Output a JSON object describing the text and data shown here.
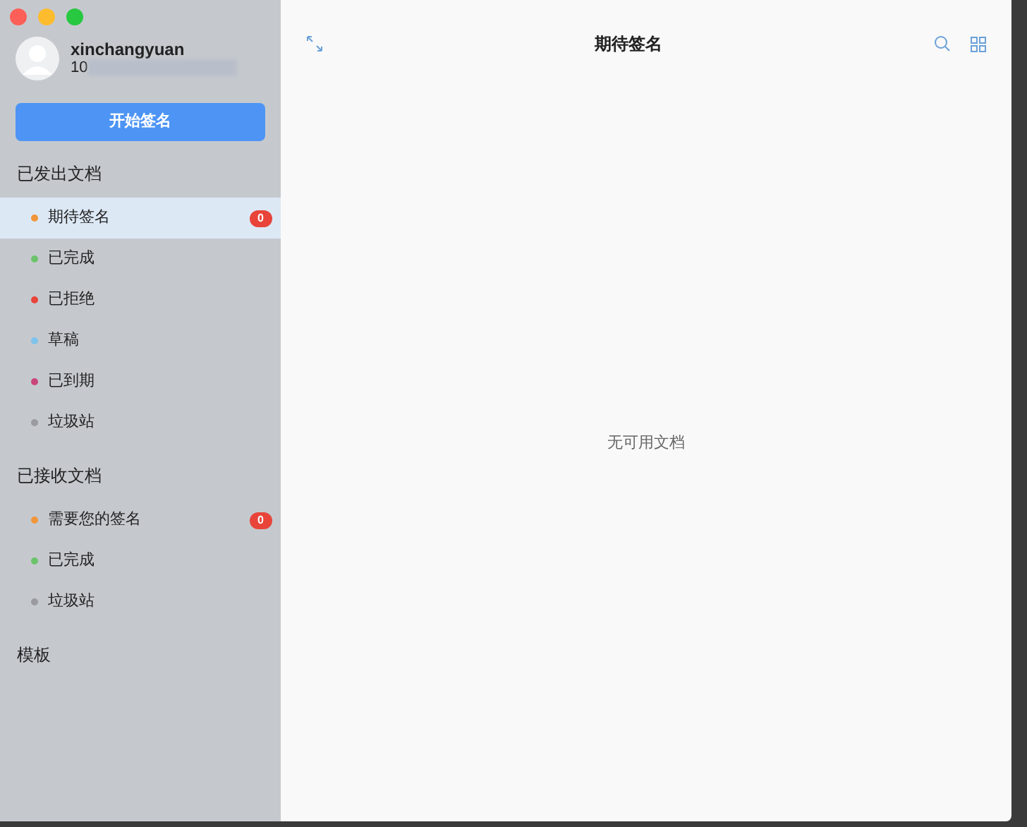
{
  "user": {
    "name": "xinchangyuan",
    "id": "10"
  },
  "start_button": "开始签名",
  "sections": [
    {
      "title": "已发出文档",
      "items": [
        {
          "label": "期待签名",
          "color": "#f0953a",
          "selected": true,
          "badge": "0"
        },
        {
          "label": "已完成",
          "color": "#6cc46a",
          "selected": false
        },
        {
          "label": "已拒绝",
          "color": "#e8443a",
          "selected": false
        },
        {
          "label": "草稿",
          "color": "#7ec3ec",
          "selected": false
        },
        {
          "label": "已到期",
          "color": "#c8467a",
          "selected": false
        },
        {
          "label": "垃圾站",
          "color": "#9a9aa0",
          "selected": false
        }
      ]
    },
    {
      "title": "已接收文档",
      "items": [
        {
          "label": "需要您的签名",
          "color": "#f0953a",
          "selected": false,
          "badge": "0"
        },
        {
          "label": "已完成",
          "color": "#6cc46a",
          "selected": false
        },
        {
          "label": "垃圾站",
          "color": "#9a9aa0",
          "selected": false
        }
      ]
    },
    {
      "title": "模板"
    }
  ],
  "header": {
    "title": "期待签名"
  },
  "empty_message": "无可用文档"
}
